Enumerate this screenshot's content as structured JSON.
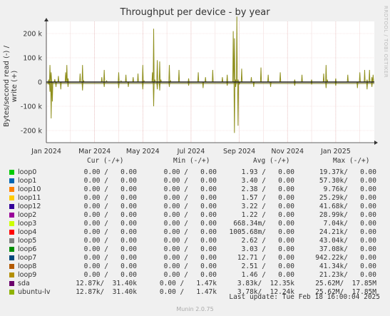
{
  "chart_data": {
    "type": "line",
    "title": "Throughput per device - by year",
    "ylabel": "Bytes/second read (-) / write (+)",
    "ylim": [
      -250000,
      250000
    ],
    "y_ticks": [
      {
        "value": 200000,
        "label": "200 k"
      },
      {
        "value": 100000,
        "label": "100 k"
      },
      {
        "value": 0,
        "label": "0"
      },
      {
        "value": -100000,
        "label": "-100 k"
      },
      {
        "value": -200000,
        "label": "-200 k"
      }
    ],
    "x_ticks": [
      "Jan 2024",
      "Mar 2024",
      "May 2024",
      "Jul 2024",
      "Sep 2024",
      "Nov 2024",
      "Jan 2025"
    ],
    "x_tick_month_offsets": [
      0,
      2,
      4,
      6,
      8,
      10,
      12
    ],
    "x_range_months": [
      0,
      13.6
    ],
    "grid": true,
    "series": [
      {
        "name": "ubuntu-lv",
        "color": "#8f8f1d",
        "write": [
          [
            0.1,
            10000
          ],
          [
            0.15,
            70000
          ],
          [
            0.2,
            40000
          ],
          [
            0.35,
            12000
          ],
          [
            0.5,
            25000
          ],
          [
            0.8,
            40000
          ],
          [
            0.85,
            70000
          ],
          [
            0.9,
            15000
          ],
          [
            1.4,
            35000
          ],
          [
            1.5,
            70000
          ],
          [
            1.55,
            5000
          ],
          [
            2.3,
            20000
          ],
          [
            2.4,
            50000
          ],
          [
            2.5,
            5000
          ],
          [
            3.0,
            40000
          ],
          [
            3.1,
            5000
          ],
          [
            3.3,
            30000
          ],
          [
            3.6,
            20000
          ],
          [
            3.8,
            35000
          ],
          [
            4.0,
            70000
          ],
          [
            4.05,
            5000
          ],
          [
            4.4,
            40000
          ],
          [
            4.45,
            220000
          ],
          [
            4.5,
            10000
          ],
          [
            4.6,
            90000
          ],
          [
            4.7,
            85000
          ],
          [
            4.75,
            10000
          ],
          [
            5.1,
            70000
          ],
          [
            5.15,
            5000
          ],
          [
            5.5,
            50000
          ],
          [
            5.9,
            15000
          ],
          [
            6.3,
            40000
          ],
          [
            6.6,
            20000
          ],
          [
            6.9,
            50000
          ],
          [
            7.3,
            20000
          ],
          [
            7.5,
            30000
          ],
          [
            7.75,
            210000
          ],
          [
            7.8,
            180000
          ],
          [
            7.85,
            10000
          ],
          [
            7.9,
            270000
          ],
          [
            7.95,
            10000
          ],
          [
            8.1,
            55000
          ],
          [
            8.5,
            20000
          ],
          [
            8.9,
            60000
          ],
          [
            9.2,
            30000
          ],
          [
            9.7,
            40000
          ],
          [
            10.3,
            10000
          ],
          [
            10.6,
            30000
          ],
          [
            11.0,
            10000
          ],
          [
            11.5,
            35000
          ],
          [
            11.6,
            70000
          ],
          [
            11.65,
            10000
          ],
          [
            12.0,
            15000
          ],
          [
            12.5,
            30000
          ],
          [
            13.0,
            40000
          ],
          [
            13.2,
            50000
          ],
          [
            13.3,
            10000
          ],
          [
            13.4,
            50000
          ],
          [
            13.5,
            20000
          ],
          [
            13.55,
            30000
          ]
        ],
        "read": [
          [
            0.1,
            -10000
          ],
          [
            0.15,
            -40000
          ],
          [
            0.2,
            -150000
          ],
          [
            0.25,
            -80000
          ],
          [
            0.4,
            -20000
          ],
          [
            0.6,
            -30000
          ],
          [
            0.9,
            -20000
          ],
          [
            1.5,
            -35000
          ],
          [
            2.4,
            -20000
          ],
          [
            3.0,
            -25000
          ],
          [
            3.4,
            -20000
          ],
          [
            4.0,
            -30000
          ],
          [
            4.45,
            -100000
          ],
          [
            4.6,
            -30000
          ],
          [
            4.7,
            -35000
          ],
          [
            5.1,
            -20000
          ],
          [
            5.9,
            -15000
          ],
          [
            6.5,
            -25000
          ],
          [
            7.5,
            -15000
          ],
          [
            7.8,
            -210000
          ],
          [
            7.85,
            -20000
          ],
          [
            7.95,
            -180000
          ],
          [
            8.0,
            -10000
          ],
          [
            8.6,
            -20000
          ],
          [
            9.3,
            -20000
          ],
          [
            10.3,
            -15000
          ],
          [
            11.0,
            -10000
          ],
          [
            11.6,
            -25000
          ],
          [
            12.0,
            -15000
          ],
          [
            12.9,
            -25000
          ],
          [
            13.3,
            -30000
          ],
          [
            13.5,
            -20000
          ]
        ]
      }
    ]
  },
  "legend": {
    "headers": {
      "cur": "Cur (-/+)",
      "min": "Min (-/+)",
      "avg": "Avg (-/+)",
      "max": "Max (-/+)"
    },
    "rows": [
      {
        "name": "loop0",
        "color": "#00cc00",
        "cur": "0.00 /   0.00",
        "min": "0.00 /   0.00",
        "avg": "1.93 /   0.00",
        "max": "19.37k/   0.00"
      },
      {
        "name": "loop1",
        "color": "#0066b3",
        "cur": "0.00 /   0.00",
        "min": "0.00 /   0.00",
        "avg": "3.40 /   0.00",
        "max": "57.30k/   0.00"
      },
      {
        "name": "loop10",
        "color": "#ff8000",
        "cur": "0.00 /   0.00",
        "min": "0.00 /   0.00",
        "avg": "2.38 /   0.00",
        "max": "9.76k/   0.00"
      },
      {
        "name": "loop11",
        "color": "#ffcc00",
        "cur": "0.00 /   0.00",
        "min": "0.00 /   0.00",
        "avg": "1.57 /   0.00",
        "max": "25.29k/   0.00"
      },
      {
        "name": "loop12",
        "color": "#330099",
        "cur": "0.00 /   0.00",
        "min": "0.00 /   0.00",
        "avg": "3.22 /   0.00",
        "max": "41.68k/   0.00"
      },
      {
        "name": "loop2",
        "color": "#990099",
        "cur": "0.00 /   0.00",
        "min": "0.00 /   0.00",
        "avg": "1.22 /   0.00",
        "max": "28.99k/   0.00"
      },
      {
        "name": "loop3",
        "color": "#ccff00",
        "cur": "0.00 /   0.00",
        "min": "0.00 /   0.00",
        "avg": "668.34m/   0.00",
        "max": "7.04k/   0.00"
      },
      {
        "name": "loop4",
        "color": "#ff0000",
        "cur": "0.00 /   0.00",
        "min": "0.00 /   0.00",
        "avg": "1005.68m/   0.00",
        "max": "24.21k/   0.00"
      },
      {
        "name": "loop5",
        "color": "#808080",
        "cur": "0.00 /   0.00",
        "min": "0.00 /   0.00",
        "avg": "2.62 /   0.00",
        "max": "43.04k/   0.00"
      },
      {
        "name": "loop6",
        "color": "#008f00",
        "cur": "0.00 /   0.00",
        "min": "0.00 /   0.00",
        "avg": "3.03 /   0.00",
        "max": "37.08k/   0.00"
      },
      {
        "name": "loop7",
        "color": "#00487d",
        "cur": "0.00 /   0.00",
        "min": "0.00 /   0.00",
        "avg": "12.71 /   0.00",
        "max": "942.22k/   0.00"
      },
      {
        "name": "loop8",
        "color": "#b35a00",
        "cur": "0.00 /   0.00",
        "min": "0.00 /   0.00",
        "avg": "2.51 /   0.00",
        "max": "41.34k/   0.00"
      },
      {
        "name": "loop9",
        "color": "#b38f00",
        "cur": "0.00 /   0.00",
        "min": "0.00 /   0.00",
        "avg": "1.46 /   0.00",
        "max": "21.23k/   0.00"
      },
      {
        "name": "sda",
        "color": "#6b006b",
        "cur": "12.87k/  31.40k",
        "min": "0.00 /   1.47k",
        "avg": "3.83k/  12.35k",
        "max": "25.62M/  17.85M"
      },
      {
        "name": "ubuntu-lv",
        "color": "#8fb300",
        "cur": "12.87k/  31.40k",
        "min": "0.00 /   1.47k",
        "avg": "3.78k/  12.24k",
        "max": "25.62M/  17.85M"
      }
    ]
  },
  "footer": {
    "last_update": "Last update: Tue Feb 18 16:00:04 2025",
    "munin_version": "Munin 2.0.75",
    "side_tag": "RRDTOOL / TOBI OETIKER"
  }
}
